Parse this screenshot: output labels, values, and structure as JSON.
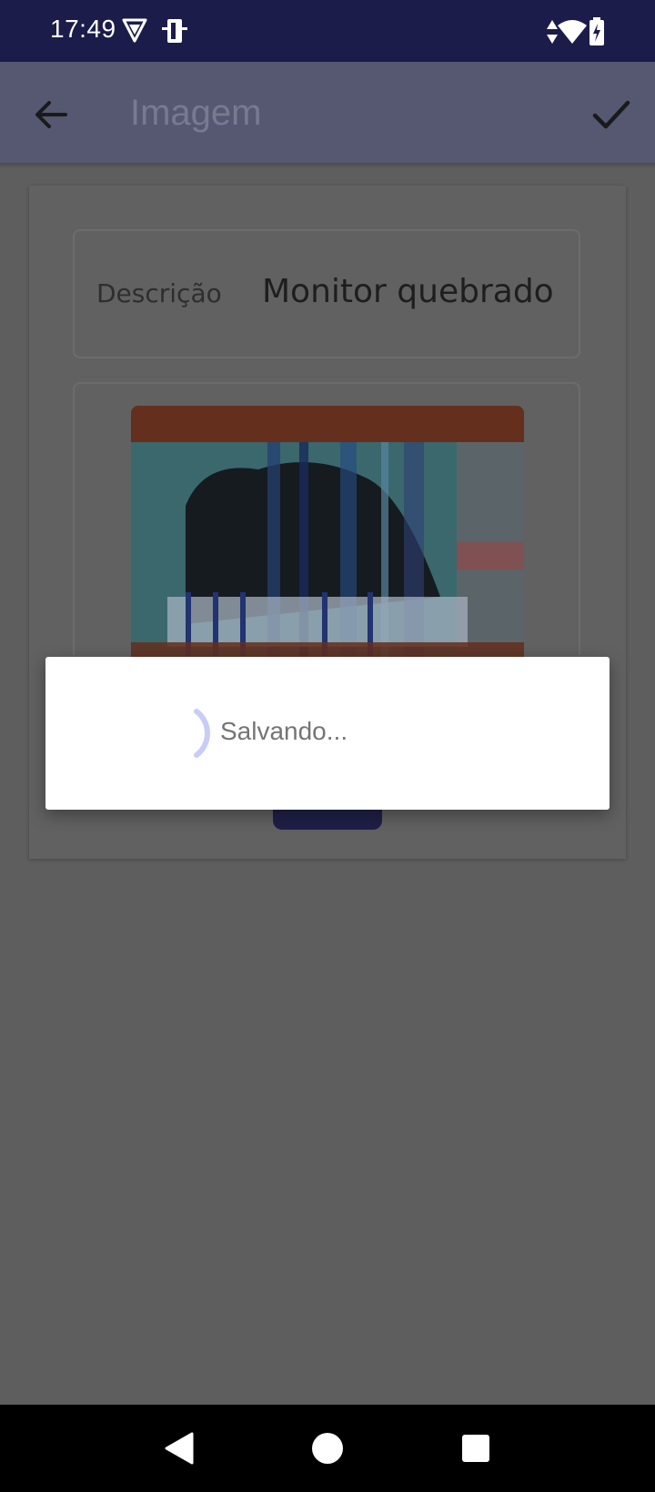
{
  "status_bar": {
    "time": "17:49",
    "left_icons": [
      "vpn-shield-icon",
      "device-storage-icon"
    ],
    "right_icons": [
      "data-arrows-icon",
      "wifi-icon",
      "battery-charging-icon"
    ]
  },
  "app_bar": {
    "title": "Imagem",
    "back_icon": "arrow-back-icon",
    "confirm_icon": "check-icon"
  },
  "form": {
    "description_label": "Descrição",
    "description_value": "Monitor quebrado"
  },
  "dialog": {
    "message": "Salvando..."
  },
  "navigation": {
    "items": [
      "back-triangle-icon",
      "home-circle-icon",
      "recents-square-icon"
    ]
  },
  "colors": {
    "status_bar": "#1c1c4a",
    "app_bar_dimmed": "#555870",
    "scrim": "#5e5e5e",
    "accent": "#1f1f47",
    "spinner": "#c9ccf7"
  }
}
